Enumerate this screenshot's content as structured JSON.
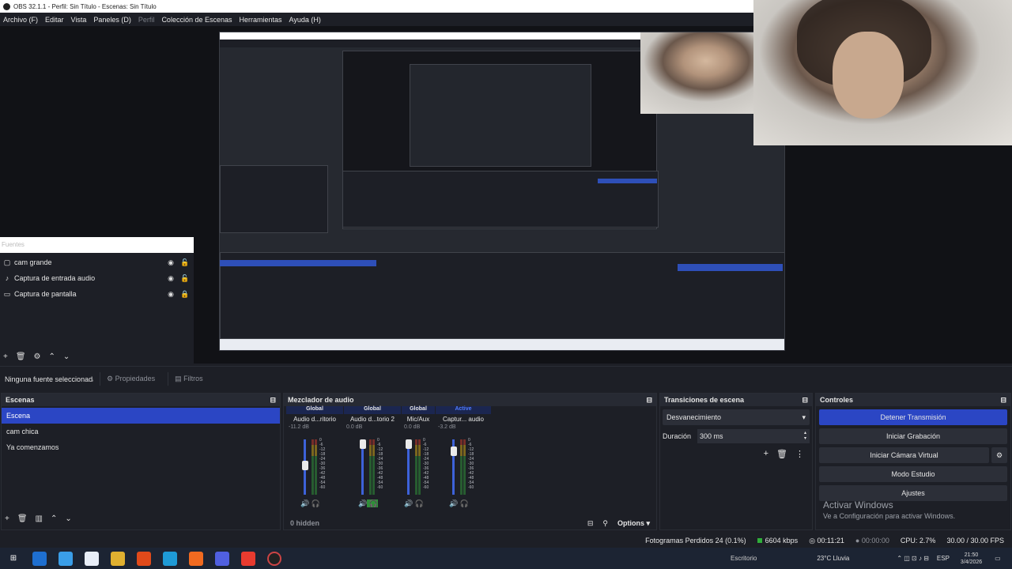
{
  "window": {
    "title": "OBS 32.1.1 - Perfil: Sin Título - Escenas: Sin Título"
  },
  "menu": {
    "items": [
      "Archivo (F)",
      "Editar",
      "Vista",
      "Paneles (D)",
      "Perfil",
      "Colección de Escenas",
      "Herramientas",
      "Ayuda (H)"
    ],
    "disabled": [
      "Perfil"
    ]
  },
  "sources": {
    "header": "Fuentes",
    "items": [
      {
        "label": "cam grande",
        "icon": "camera-icon",
        "locked": false
      },
      {
        "label": "Captura de entrada audio",
        "icon": "microphone-icon",
        "locked": false
      },
      {
        "label": "Captura de pantalla",
        "icon": "monitor-icon",
        "locked": true
      }
    ]
  },
  "propbar": {
    "no_source": "Ninguna fuente seleccionada",
    "properties": "Propiedades",
    "filters": "Filtros"
  },
  "scenes": {
    "title": "Escenas",
    "items": [
      "Escena",
      "cam chica",
      "Ya comenzamos"
    ],
    "selected": "Escena"
  },
  "mixer": {
    "title": "Mezclador de audio",
    "hidden": "0 hidden",
    "options": "Options",
    "scale": [
      "0",
      "-6",
      "-12",
      "-18",
      "-24",
      "-30",
      "-36",
      "-42",
      "-48",
      "-54",
      "-60"
    ],
    "channels": [
      {
        "tag": "Global",
        "name": "Audio d...ritorio",
        "db": "-11.2 dB",
        "level": 0.55
      },
      {
        "tag": "Global",
        "name": "Audio d...torio 2",
        "db": "0.0 dB",
        "level": 1.0
      },
      {
        "tag": "Global",
        "name": "Mic/Aux",
        "db": "0.0 dB",
        "level": 1.0
      },
      {
        "tag": "Active",
        "name": "Captur... audio",
        "db": "-3.2 dB",
        "level": 0.85
      }
    ]
  },
  "transitions": {
    "title": "Transiciones de escena",
    "type": "Desvanecimiento",
    "duration_label": "Duración",
    "duration_value": "300 ms"
  },
  "controls": {
    "title": "Controles",
    "buttons": [
      "Detener Transmisión",
      "Iniciar Grabación",
      "Iniciar Cámara Virtual",
      "Modo Estudio",
      "Ajustes"
    ]
  },
  "watermark": {
    "line1": "Activar Windows",
    "line2": "Ve a Configuración para activar Windows."
  },
  "status": {
    "dropped": "Fotogramas Perdidos 24 (0.1%)",
    "bitrate": "6604 kbps",
    "stream_time": "00:11:21",
    "rec_time": "00:00:00",
    "cpu": "CPU: 2.7%",
    "fps": "30.00 / 30.00 FPS"
  },
  "taskbar": {
    "search_label": "Escritorio",
    "weather": "23°C Lluvia",
    "lang": "ESP",
    "time": "21:50",
    "date": "3/4/2026"
  },
  "colors": {
    "accent": "#2b46c4",
    "panel": "#1d1f26",
    "meter_green": "#2f8f39"
  }
}
